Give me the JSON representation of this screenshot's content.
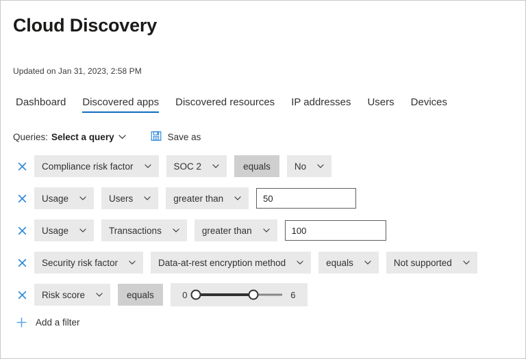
{
  "header": {
    "title": "Cloud Discovery",
    "updated": "Updated on Jan 31, 2023, 2:58 PM"
  },
  "tabs": [
    {
      "label": "Dashboard",
      "active": false
    },
    {
      "label": "Discovered apps",
      "active": true
    },
    {
      "label": "Discovered resources",
      "active": false
    },
    {
      "label": "IP addresses",
      "active": false
    },
    {
      "label": "Users",
      "active": false
    },
    {
      "label": "Devices",
      "active": false
    }
  ],
  "queries": {
    "label": "Queries:",
    "selected": "Select a query",
    "chevron_icon": "chevron-down-icon",
    "save_icon": "save-floppy-icon",
    "save_label": "Save as"
  },
  "filters": {
    "remove_icon": "close-x-icon",
    "rows": [
      {
        "name": "compliance-risk-factor",
        "fields": [
          {
            "kind": "dropdown",
            "name": "filter-category",
            "label": "Compliance risk factor"
          },
          {
            "kind": "dropdown",
            "name": "filter-attribute",
            "label": "SOC 2"
          },
          {
            "kind": "static",
            "name": "filter-operator",
            "label": "equals"
          },
          {
            "kind": "dropdown",
            "name": "filter-value",
            "label": "No"
          }
        ]
      },
      {
        "name": "usage-users",
        "fields": [
          {
            "kind": "dropdown",
            "name": "filter-category",
            "label": "Usage"
          },
          {
            "kind": "dropdown",
            "name": "filter-attribute",
            "label": "Users"
          },
          {
            "kind": "dropdown",
            "name": "filter-operator",
            "label": "greater than"
          },
          {
            "kind": "input",
            "name": "filter-value-input",
            "value": "50",
            "placeholder": ""
          }
        ]
      },
      {
        "name": "usage-transactions",
        "fields": [
          {
            "kind": "dropdown",
            "name": "filter-category",
            "label": "Usage"
          },
          {
            "kind": "dropdown",
            "name": "filter-attribute",
            "label": "Transactions"
          },
          {
            "kind": "dropdown",
            "name": "filter-operator",
            "label": "greater than"
          },
          {
            "kind": "input",
            "name": "filter-value-input",
            "value": "100",
            "placeholder": ""
          }
        ]
      },
      {
        "name": "security-risk-factor",
        "fields": [
          {
            "kind": "dropdown",
            "name": "filter-category",
            "label": "Security risk factor"
          },
          {
            "kind": "dropdown",
            "name": "filter-attribute",
            "label": "Data-at-rest encryption method"
          },
          {
            "kind": "dropdown",
            "name": "filter-operator",
            "label": "equals"
          },
          {
            "kind": "dropdown",
            "name": "filter-value",
            "label": "Not supported"
          }
        ]
      },
      {
        "name": "risk-score",
        "fields": [
          {
            "kind": "dropdown",
            "name": "filter-category",
            "label": "Risk score"
          },
          {
            "kind": "static",
            "name": "filter-operator",
            "label": "equals"
          },
          {
            "kind": "slider",
            "name": "risk-score-range-slider",
            "min_label": "0",
            "max_label": "6",
            "min": 0,
            "max": 6,
            "low_value": 0,
            "high_value": 4
          }
        ]
      }
    ]
  },
  "add_filter": {
    "icon": "plus-icon",
    "label": "Add a filter"
  },
  "colors": {
    "accent": "#0f6cbd",
    "icon_blue": "#2b88d8",
    "pill_bg": "#e9e9e9",
    "pill_static_bg": "#cfcfcf",
    "text": "#323130",
    "slider_fill": "#323130",
    "slider_rail": "#8a8886"
  }
}
